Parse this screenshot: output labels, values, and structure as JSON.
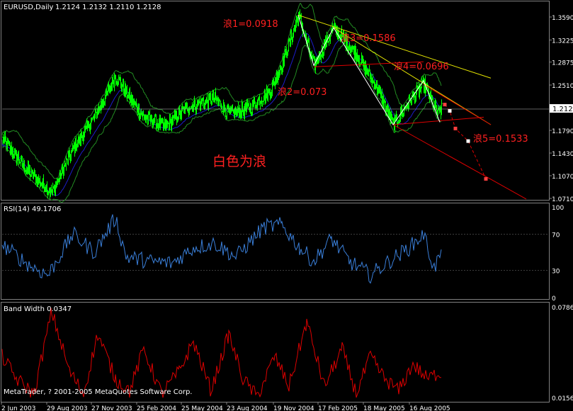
{
  "header": {
    "symbol": "EURUSD,Daily",
    "ohlc": "1.2124 1.2132 1.2110 1.2128"
  },
  "main_price_axis": [
    "1.3590",
    "1.3225",
    "1.2875",
    "1.2510",
    "1.2128",
    "1.1790",
    "1.1430",
    "1.1070",
    "1.0710"
  ],
  "current_price": "1.2128",
  "annotations": {
    "wave1": "浪1=0.0918",
    "wave2": "浪2=0.073",
    "wave3": "浪3=0.1586",
    "wave4": "浪4=0.0696",
    "wave5": "浪5=0.1533",
    "white_wave": "白色为浪"
  },
  "rsi": {
    "label": "RSI(14) 49.1706",
    "axis": [
      "100",
      "70",
      "30",
      "0"
    ]
  },
  "bandwidth": {
    "label": "Band Width 0.0347",
    "axis_top": "0.0786",
    "axis_bottom": "0.0156"
  },
  "copyright": "MetaTrader, ? 2001-2005 MetaQuotes Software Corp.",
  "x_axis": [
    "2 Jun 2003",
    "29 Aug 2003",
    "27 Nov 2003",
    "25 Feb 2004",
    "25 May 2004",
    "23 Aug 2004",
    "19 Nov 2004",
    "17 Feb 2005",
    "18 May 2005",
    "16 Aug 2005"
  ],
  "colors": {
    "price": "#00ff00",
    "bands": "#228b22",
    "ma": "#1c1cc8",
    "rsi": "#3a7fd9",
    "bandwidth": "#dd0000",
    "trend_yellow": "#e6e600",
    "trend_red": "#dd0000",
    "label_red": "#ff2020",
    "grid": "#808080"
  },
  "chart_data": {
    "type": "line",
    "price_pivots": [
      [
        0,
        1.165
      ],
      [
        40,
        1.11
      ],
      [
        70,
        1.08
      ],
      [
        100,
        1.15
      ],
      [
        130,
        1.2
      ],
      [
        160,
        1.265
      ],
      [
        180,
        1.23
      ],
      [
        200,
        1.2
      ],
      [
        230,
        1.185
      ],
      [
        260,
        1.215
      ],
      [
        300,
        1.23
      ],
      [
        320,
        1.205
      ],
      [
        350,
        1.215
      ],
      [
        380,
        1.245
      ],
      [
        400,
        1.3
      ],
      [
        418,
        1.362
      ],
      [
        440,
        1.282
      ],
      [
        468,
        1.342
      ],
      [
        500,
        1.3
      ],
      [
        530,
        1.245
      ],
      [
        552,
        1.188
      ],
      [
        575,
        1.225
      ],
      [
        595,
        1.252
      ],
      [
        615,
        1.205
      ],
      [
        620,
        1.212
      ]
    ],
    "waves_white": [
      [
        418,
        1.362
      ],
      [
        440,
        1.282
      ],
      [
        468,
        1.342
      ],
      [
        552,
        1.188
      ],
      [
        595,
        1.258
      ],
      [
        618,
        1.192
      ]
    ],
    "projection": [
      [
        625,
        1.22
      ],
      [
        632,
        1.21
      ],
      [
        640,
        1.182
      ],
      [
        658,
        1.162
      ],
      [
        683,
        1.102
      ]
    ],
    "rsi_pivots": [
      [
        0,
        58
      ],
      [
        40,
        35
      ],
      [
        65,
        25
      ],
      [
        100,
        70
      ],
      [
        130,
        50
      ],
      [
        160,
        88
      ],
      [
        175,
        45
      ],
      [
        210,
        40
      ],
      [
        240,
        38
      ],
      [
        270,
        55
      ],
      [
        300,
        60
      ],
      [
        330,
        45
      ],
      [
        370,
        78
      ],
      [
        395,
        80
      ],
      [
        420,
        55
      ],
      [
        440,
        40
      ],
      [
        465,
        65
      ],
      [
        490,
        40
      ],
      [
        520,
        25
      ],
      [
        550,
        42
      ],
      [
        575,
        55
      ],
      [
        595,
        70
      ],
      [
        610,
        32
      ],
      [
        620,
        50
      ]
    ],
    "bandwidth_pivots": [
      [
        0,
        0.045
      ],
      [
        20,
        0.03
      ],
      [
        45,
        0.02
      ],
      [
        70,
        0.075
      ],
      [
        95,
        0.035
      ],
      [
        115,
        0.02
      ],
      [
        135,
        0.06
      ],
      [
        160,
        0.03
      ],
      [
        180,
        0.022
      ],
      [
        200,
        0.05
      ],
      [
        225,
        0.02
      ],
      [
        250,
        0.035
      ],
      [
        270,
        0.055
      ],
      [
        295,
        0.022
      ],
      [
        320,
        0.06
      ],
      [
        340,
        0.03
      ],
      [
        360,
        0.018
      ],
      [
        385,
        0.045
      ],
      [
        405,
        0.025
      ],
      [
        430,
        0.068
      ],
      [
        455,
        0.025
      ],
      [
        480,
        0.05
      ],
      [
        500,
        0.02
      ],
      [
        520,
        0.045
      ],
      [
        540,
        0.03
      ],
      [
        560,
        0.022
      ],
      [
        580,
        0.04
      ],
      [
        600,
        0.03
      ],
      [
        620,
        0.035
      ]
    ],
    "price_ylim": [
      1.071,
      1.359
    ],
    "rsi_ylim": [
      0,
      100
    ],
    "bandwidth_ylim": [
      0.0156,
      0.0786
    ]
  }
}
